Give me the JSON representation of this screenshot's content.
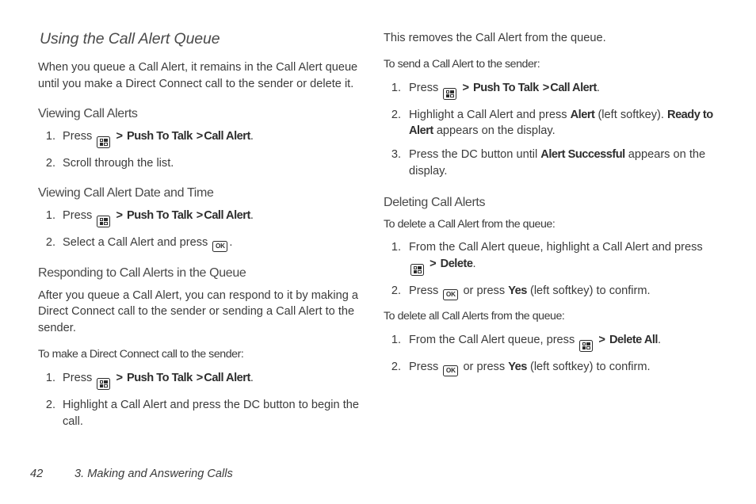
{
  "page": {
    "title": "Using the Call Alert Queue",
    "footer": {
      "page_number": "42",
      "chapter": "3. Making and Answering Calls"
    }
  },
  "icons": {
    "menu_key": "menu-key-icon",
    "ok_key": "ok-key-icon",
    "ok_label": "OK",
    "separator": ">"
  },
  "left_column": {
    "intro_paragraph": "When you queue a Call Alert, it remains in the Call Alert queue until you make a Direct Connect call to the sender or delete it.",
    "section_viewing": {
      "heading": "Viewing Call Alerts",
      "step1": {
        "press": "Press",
        "menu_path_1": "Push To Talk",
        "menu_path_2": "Call Alert",
        "trailing": "."
      },
      "step2": "Scroll through the list."
    },
    "section_date_time": {
      "heading": "Viewing Call Alert Date and Time",
      "step1": {
        "press": "Press",
        "menu_path_1": "Push To Talk",
        "menu_path_2": "Call Alert",
        "trailing": "."
      },
      "step2": {
        "text_before": "Select a Call Alert and press",
        "text_after": "."
      }
    },
    "section_responding": {
      "heading": "Responding to Call Alerts in the Queue",
      "paragraph": "After you queue a Call Alert, you can respond to it by making a Direct Connect call to the sender or sending a Call Alert to the sender.",
      "lead": "To make a Direct Connect call to the sender:",
      "step1": {
        "press": "Press",
        "menu_path_1": "Push To Talk",
        "menu_path_2": "Call Alert",
        "trailing": "."
      },
      "step2": "Highlight a Call Alert and press the DC button to begin the call."
    }
  },
  "right_column": {
    "removes_paragraph": "This removes the Call Alert from the queue.",
    "section_send": {
      "lead": "To send a Call Alert to the sender:",
      "step1": {
        "press": "Press",
        "menu_path_1": "Push To Talk",
        "menu_path_2": "Call Alert",
        "trailing": "."
      },
      "step2": {
        "text_before": "Highlight a Call Alert and press",
        "softkey": "Alert",
        "text_middle": "(left softkey).",
        "bold_status": "Ready to Alert",
        "text_after": "appears on the display."
      },
      "step3": {
        "text_before": "Press the DC button until",
        "bold_status": "Alert Successful",
        "text_after": "appears on the display."
      }
    },
    "section_deleting": {
      "heading": "Deleting Call Alerts",
      "lead_one": "To delete a Call Alert from the queue:",
      "one_step1": {
        "text_before": "From the Call Alert queue, highlight a Call Alert and press",
        "menu_item": "Delete",
        "trailing": "."
      },
      "one_step2": {
        "press": "Press",
        "text_middle": "or press",
        "softkey": "Yes",
        "text_after": "(left softkey) to confirm."
      },
      "lead_all": "To delete all Call Alerts from the queue:",
      "all_step1": {
        "text_before": "From the Call Alert queue, press",
        "menu_item": "Delete All",
        "trailing": "."
      },
      "all_step2": {
        "press": "Press",
        "text_middle": "or press",
        "softkey": "Yes",
        "text_after": "(left softkey) to confirm."
      }
    }
  }
}
